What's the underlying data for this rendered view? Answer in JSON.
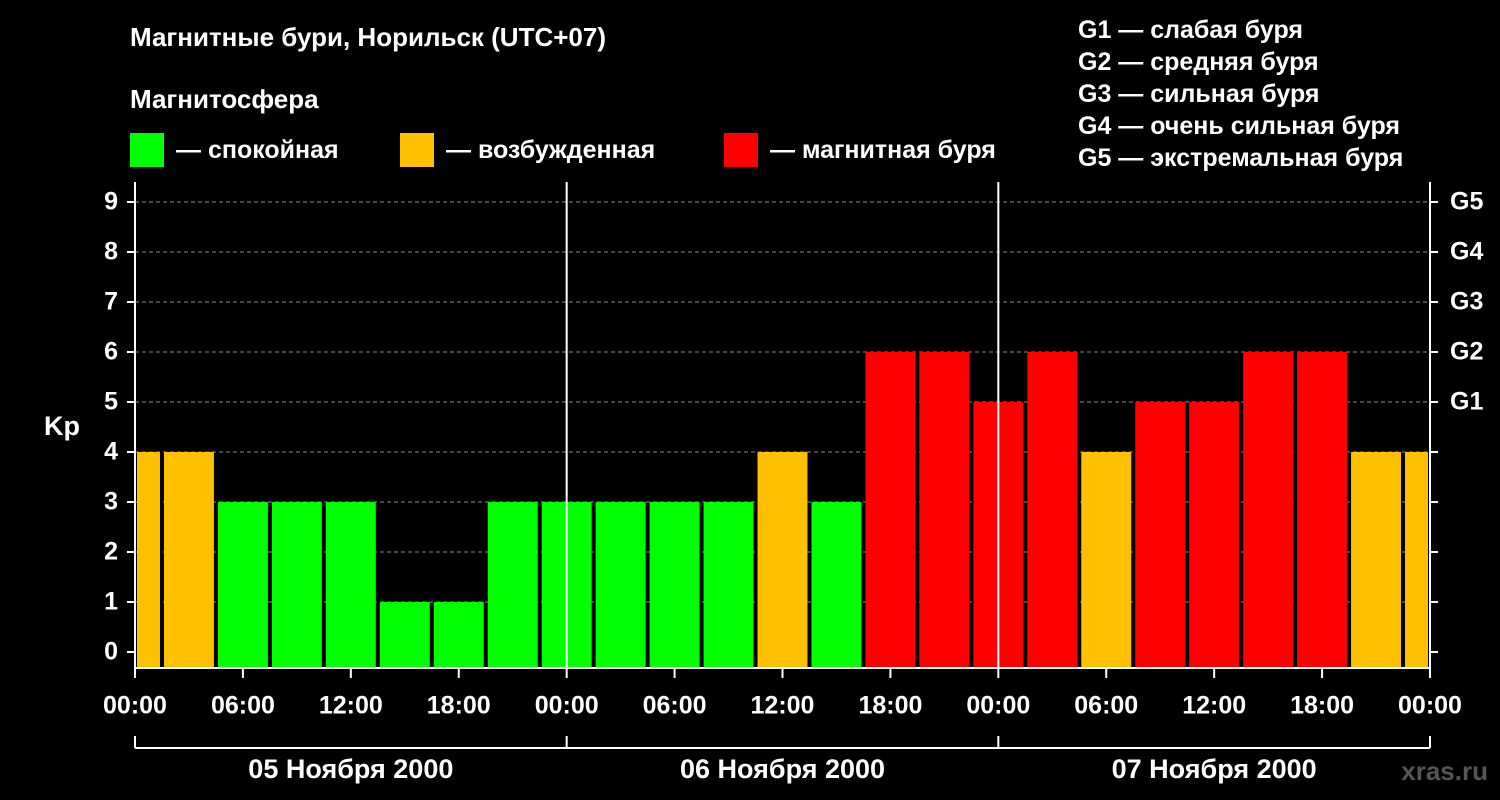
{
  "title": "Магнитные бури, Норильск (UTC+07)",
  "subtitle": "Магнитосфера",
  "legend": [
    {
      "label": "— спокойная",
      "color": "#00FF00"
    },
    {
      "label": "— возбужденная",
      "color": "#FFC000"
    },
    {
      "label": "— магнитная буря",
      "color": "#FF0000"
    }
  ],
  "g_scale": [
    "G1 — слабая буря",
    "G2 — средняя буря",
    "G3 — сильная буря",
    "G4 — очень сильная буря",
    "G5 — экстремальная буря"
  ],
  "watermark": "xras.ru",
  "chart_data": {
    "type": "bar",
    "ylabel": "Kp",
    "ylim": [
      0,
      9
    ],
    "yticks": [
      "0",
      "1",
      "2",
      "3",
      "4",
      "5",
      "6",
      "7",
      "8",
      "9"
    ],
    "right_ticks": [
      {
        "value": 5,
        "label": "G1"
      },
      {
        "value": 6,
        "label": "G2"
      },
      {
        "value": 7,
        "label": "G3"
      },
      {
        "value": 8,
        "label": "G4"
      },
      {
        "value": 9,
        "label": "G5"
      }
    ],
    "xticks": [
      "00:00",
      "06:00",
      "12:00",
      "18:00",
      "00:00",
      "06:00",
      "12:00",
      "18:00",
      "00:00",
      "06:00",
      "12:00",
      "18:00",
      "00:00"
    ],
    "days": [
      "05 Ноября 2000",
      "06 Ноября 2000",
      "07 Ноября 2000"
    ],
    "grid": true,
    "colors": {
      "quiet": "#00FF00",
      "active": "#FFC000",
      "storm": "#FF0000"
    },
    "bars": [
      {
        "start_hour": 0,
        "end_hour": 1.5,
        "kp": 4
      },
      {
        "start_hour": 1.5,
        "end_hour": 4.5,
        "kp": 4
      },
      {
        "start_hour": 4.5,
        "end_hour": 7.5,
        "kp": 3
      },
      {
        "start_hour": 7.5,
        "end_hour": 10.5,
        "kp": 3
      },
      {
        "start_hour": 10.5,
        "end_hour": 13.5,
        "kp": 3
      },
      {
        "start_hour": 13.5,
        "end_hour": 16.5,
        "kp": 1
      },
      {
        "start_hour": 16.5,
        "end_hour": 19.5,
        "kp": 1
      },
      {
        "start_hour": 19.5,
        "end_hour": 22.5,
        "kp": 3
      },
      {
        "start_hour": 22.5,
        "end_hour": 25.5,
        "kp": 3
      },
      {
        "start_hour": 25.5,
        "end_hour": 28.5,
        "kp": 3
      },
      {
        "start_hour": 28.5,
        "end_hour": 31.5,
        "kp": 3
      },
      {
        "start_hour": 31.5,
        "end_hour": 34.5,
        "kp": 3
      },
      {
        "start_hour": 34.5,
        "end_hour": 37.5,
        "kp": 4
      },
      {
        "start_hour": 37.5,
        "end_hour": 40.5,
        "kp": 3
      },
      {
        "start_hour": 40.5,
        "end_hour": 43.5,
        "kp": 6
      },
      {
        "start_hour": 43.5,
        "end_hour": 46.5,
        "kp": 6
      },
      {
        "start_hour": 46.5,
        "end_hour": 49.5,
        "kp": 5
      },
      {
        "start_hour": 49.5,
        "end_hour": 52.5,
        "kp": 6
      },
      {
        "start_hour": 52.5,
        "end_hour": 55.5,
        "kp": 4
      },
      {
        "start_hour": 55.5,
        "end_hour": 58.5,
        "kp": 5
      },
      {
        "start_hour": 58.5,
        "end_hour": 61.5,
        "kp": 5
      },
      {
        "start_hour": 61.5,
        "end_hour": 64.5,
        "kp": 6
      },
      {
        "start_hour": 64.5,
        "end_hour": 67.5,
        "kp": 6
      },
      {
        "start_hour": 67.5,
        "end_hour": 70.5,
        "kp": 4
      },
      {
        "start_hour": 70.5,
        "end_hour": 72,
        "kp": 4
      }
    ]
  }
}
